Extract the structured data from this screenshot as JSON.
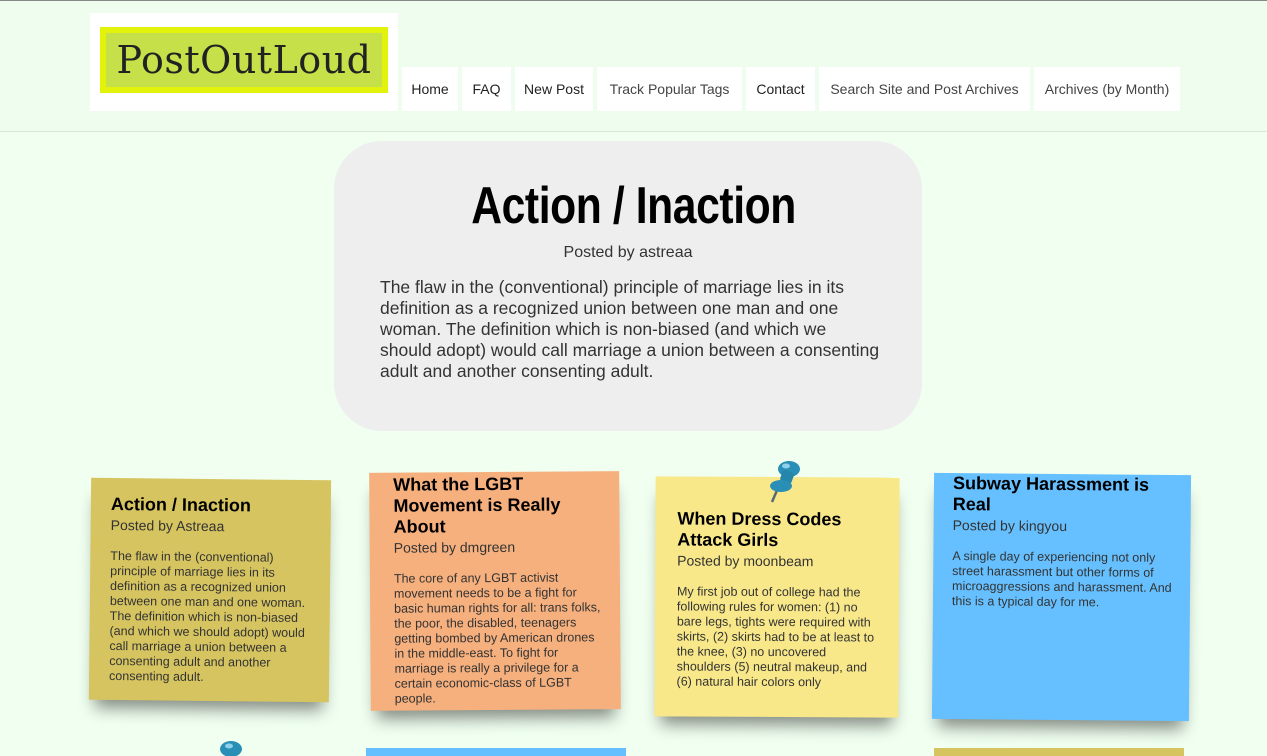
{
  "site": {
    "logo_text": "PostOutLoud"
  },
  "nav": {
    "items": [
      {
        "label": "Home"
      },
      {
        "label": "FAQ"
      },
      {
        "label": "New Post"
      },
      {
        "label": "Track Popular Tags"
      },
      {
        "label": "Contact"
      },
      {
        "label": "Search Site and Post Archives"
      },
      {
        "label": "Archives (by Month)"
      }
    ]
  },
  "featured": {
    "title": "Action / Inaction",
    "byline": "Posted by astreaa",
    "body": "The flaw in the (conventional) principle of marriage lies in its definition as a recognized union between one man and one woman. The definition which is non-biased (and which we should adopt) would call marriage a union between a consenting adult and another consenting adult."
  },
  "notes": [
    {
      "title": "Action / Inaction",
      "byline": "Posted by Astreaa",
      "body": "The flaw in the (conventional) principle of marriage lies in its definition as a recognized union between one man and one woman. The definition which is non-biased (and which we should adopt) would call marriage a union between a consenting adult and another consenting adult.",
      "color": "#d6c460"
    },
    {
      "title": "What the LGBT Movement is Really About",
      "byline": "Posted by dmgreen",
      "body": "The core of any LGBT activist movement needs to be a fight for basic human rights for all: trans folks, the poor, the disabled, teenagers getting bombed by American drones in the middle-east. To fight for marriage is really a privilege for a certain economic-class of LGBT people.",
      "color": "#f6b07e"
    },
    {
      "title": "When Dress Codes Attack Girls",
      "byline": "Posted by moonbeam",
      "body": "My first job out of college had the following rules for women: (1) no bare legs, tights were required with skirts, (2) skirts had to be at least to the knee, (3) no uncovered shoulders (5) neutral makeup, and (6) natural hair colors only",
      "color": "#f8e88a"
    },
    {
      "title": "Subway Harassment is Real",
      "byline": "Posted by kingyou",
      "body": "A single day of experiencing not only street harassment but other forms of microaggressions and harassment. And this is a typical day for me.",
      "color": "#66c0ff"
    }
  ],
  "colors": {
    "page_bg": "#f0fff0",
    "logo_highlight": "#e2f20a",
    "pin": "#2a8fb6"
  },
  "icons": {
    "pin": "pushpin-icon"
  }
}
